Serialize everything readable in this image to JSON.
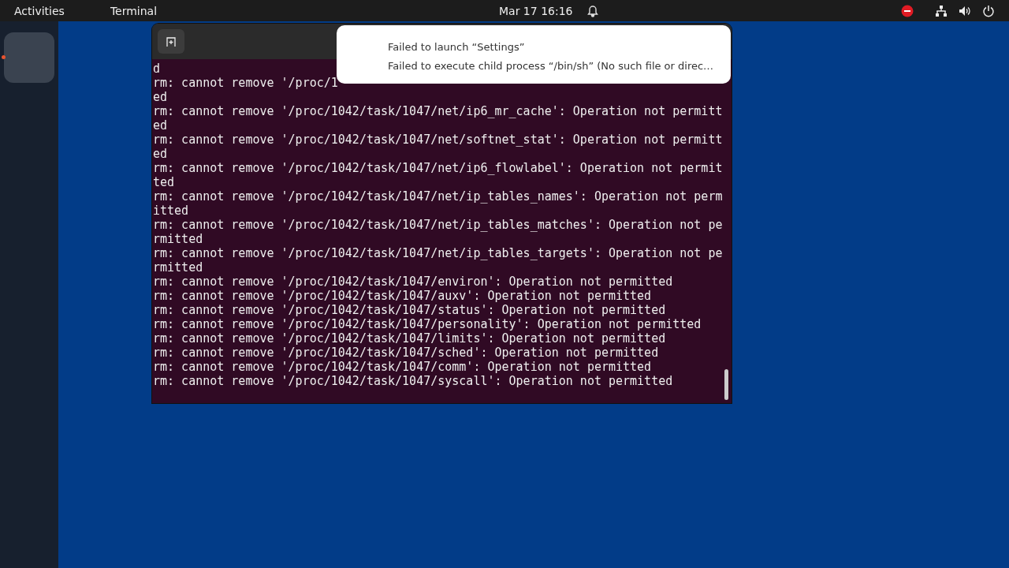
{
  "top_bar": {
    "activities": "Activities",
    "app_menu": "Terminal",
    "clock": "Mar 17  16:16"
  },
  "dock": {
    "items": [
      {
        "kind": "app",
        "running": true
      }
    ]
  },
  "terminal": {
    "lines": [
      "d",
      "rm: cannot remove '/proc/1",
      "ed",
      "rm: cannot remove '/proc/1042/task/1047/net/ip6_mr_cache': Operation not permitt",
      "ed",
      "rm: cannot remove '/proc/1042/task/1047/net/softnet_stat': Operation not permitt",
      "ed",
      "rm: cannot remove '/proc/1042/task/1047/net/ip6_flowlabel': Operation not permit",
      "ted",
      "rm: cannot remove '/proc/1042/task/1047/net/ip_tables_names': Operation not perm",
      "itted",
      "rm: cannot remove '/proc/1042/task/1047/net/ip_tables_matches': Operation not pe",
      "rmitted",
      "rm: cannot remove '/proc/1042/task/1047/net/ip_tables_targets': Operation not pe",
      "rmitted",
      "rm: cannot remove '/proc/1042/task/1047/environ': Operation not permitted",
      "rm: cannot remove '/proc/1042/task/1047/auxv': Operation not permitted",
      "rm: cannot remove '/proc/1042/task/1047/status': Operation not permitted",
      "rm: cannot remove '/proc/1042/task/1047/personality': Operation not permitted",
      "rm: cannot remove '/proc/1042/task/1047/limits': Operation not permitted",
      "rm: cannot remove '/proc/1042/task/1047/sched': Operation not permitted",
      "rm: cannot remove '/proc/1042/task/1047/comm': Operation not permitted",
      "rm: cannot remove '/proc/1042/task/1047/syscall': Operation not permitted"
    ]
  },
  "notification": {
    "title": "Failed to launch “Settings”",
    "body": "Failed to execute child process “/bin/sh” (No such file or direc…"
  }
}
